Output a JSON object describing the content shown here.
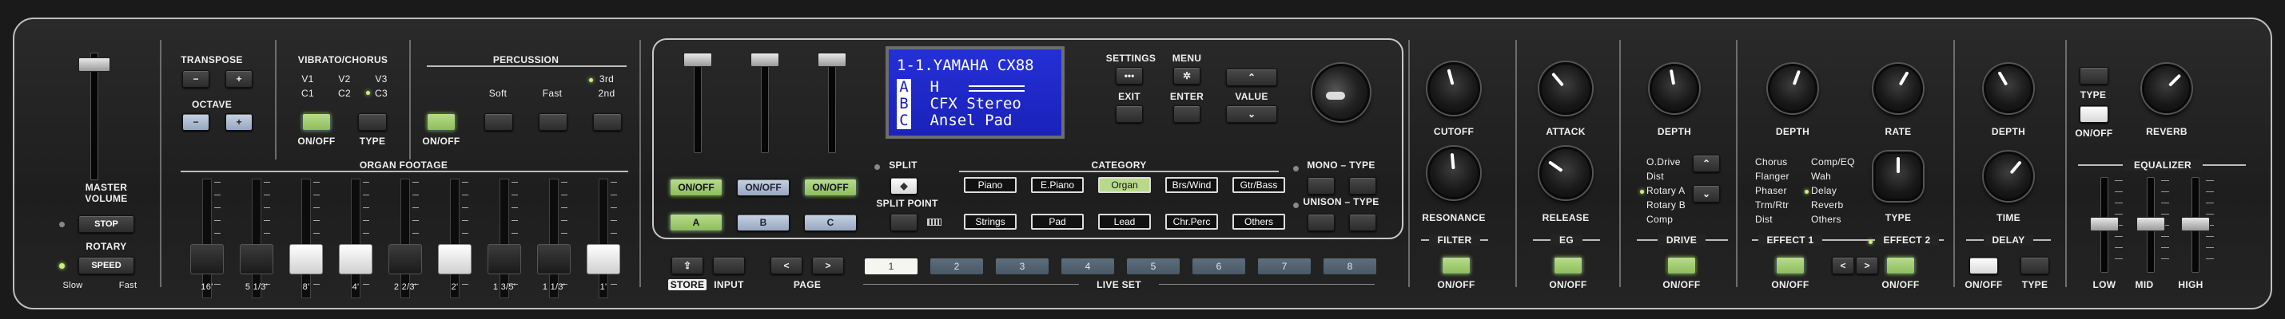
{
  "master": {
    "volume_label_1": "MASTER",
    "volume_label_2": "VOLUME",
    "stop": "STOP",
    "rotary": "ROTARY",
    "speed": "SPEED",
    "slow": "Slow",
    "fast": "Fast"
  },
  "transpose": {
    "label": "TRANSPOSE",
    "minus": "−",
    "plus": "+"
  },
  "octave": {
    "label": "OCTAVE",
    "minus": "−",
    "plus": "+"
  },
  "vibrato": {
    "label": "VIBRATO/CHORUS",
    "v1": "V1",
    "v2": "V2",
    "v3": "V3",
    "c1": "C1",
    "c2": "C2",
    "c3": "C3",
    "onoff": "ON/OFF",
    "type": "TYPE"
  },
  "percussion": {
    "label": "PERCUSSION",
    "soft": "Soft",
    "fast": "Fast",
    "third": "3rd",
    "second": "2nd",
    "onoff": "ON/OFF"
  },
  "organ_footage": {
    "label": "ORGAN FOOTAGE",
    "bars": [
      "16'",
      "5 1/3'",
      "8'",
      "4'",
      "2 2/3'",
      "2'",
      "1 3/5'",
      "1 1/3'",
      "1'"
    ]
  },
  "sliders": {
    "labels": [
      "A",
      "B",
      "C"
    ],
    "onoff": "ON/OFF"
  },
  "lcd": {
    "line1": "1-1.YAMAHA CX88",
    "rowA_label": "A",
    "rowA_value": "H",
    "rowB_label": "B",
    "rowB_value": "CFX Stereo",
    "rowC_label": "C",
    "rowC_value": "Ansel Pad"
  },
  "controls": {
    "settings": "SETTINGS",
    "menu": "MENU",
    "exit": "EXIT",
    "enter": "ENTER",
    "value": "VALUE",
    "split": "SPLIT",
    "split_point": "SPLIT POINT",
    "mono_type": "MONO – TYPE",
    "unison_type": "UNISON – TYPE"
  },
  "category": {
    "label": "CATEGORY",
    "items": [
      "Piano",
      "E.Piano",
      "Organ",
      "Brs/Wind",
      "Gtr/Bass",
      "Strings",
      "Pad",
      "Lead",
      "Chr.Perc",
      "Others"
    ]
  },
  "filter": {
    "cutoff": "CUTOFF",
    "resonance": "RESONANCE",
    "label": "FILTER",
    "onoff": "ON/OFF"
  },
  "eg": {
    "attack": "ATTACK",
    "release": "RELEASE",
    "label": "EG",
    "onoff": "ON/OFF"
  },
  "drive": {
    "depth": "DEPTH",
    "types": [
      "O.Drive",
      "Dist",
      "Rotary A",
      "Rotary B",
      "Comp"
    ],
    "label": "DRIVE",
    "onoff": "ON/OFF"
  },
  "effects": {
    "depth": "DEPTH",
    "rate": "RATE",
    "type": "TYPE",
    "col1": [
      "Chorus",
      "Flanger",
      "Phaser",
      "Trm/Rtr",
      "Dist"
    ],
    "col2": [
      "Comp/EQ",
      "Wah",
      "Delay",
      "Reverb",
      "Others"
    ],
    "effect1": "EFFECT 1",
    "effect2": "EFFECT 2",
    "onoff": "ON/OFF"
  },
  "delay": {
    "depth": "DEPTH",
    "time": "TIME",
    "label": "DELAY",
    "onoff": "ON/OFF",
    "type": "TYPE"
  },
  "reverb": {
    "type": "TYPE",
    "reverb": "REVERB",
    "onoff": "ON/OFF"
  },
  "equalizer": {
    "label": "EQUALIZER",
    "low": "LOW",
    "mid": "MID",
    "high": "HIGH"
  },
  "bottom": {
    "store": "STORE",
    "input": "INPUT",
    "page": "PAGE",
    "live_set": "LIVE SET",
    "pages": [
      "1",
      "2",
      "3",
      "4",
      "5",
      "6",
      "7",
      "8"
    ]
  }
}
